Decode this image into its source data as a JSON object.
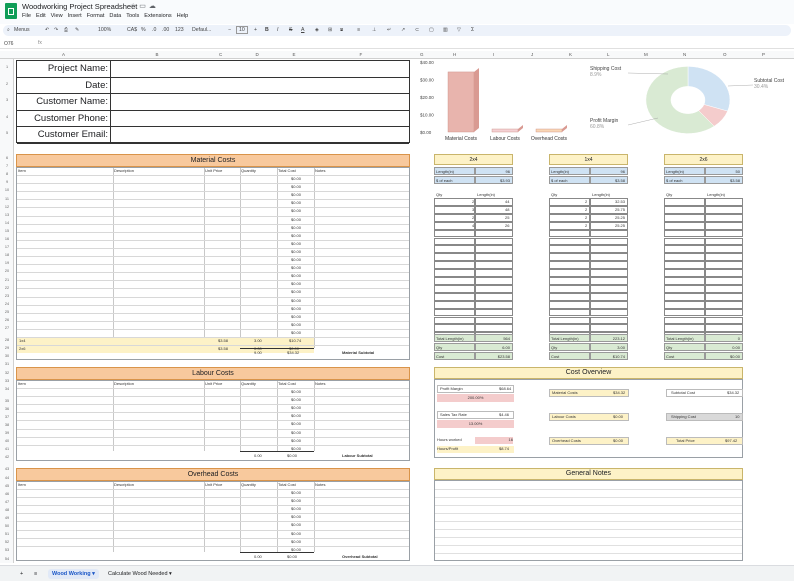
{
  "app": {
    "title": "Woodworking Project Spreadsheet",
    "menu": [
      "File",
      "Edit",
      "View",
      "Insert",
      "Format",
      "Data",
      "Tools",
      "Extensions",
      "Help"
    ],
    "toolbar": {
      "search": "Menus",
      "zoom": "100%",
      "currency": "CA$",
      "percent": "%",
      "dec1": ".0",
      "dec2": ".00",
      "num": "123",
      "font": "Defaul...",
      "fontsize": "10"
    },
    "cellref": "O76"
  },
  "columns": [
    "A",
    "B",
    "C",
    "D",
    "E",
    "F",
    "G",
    "H",
    "I",
    "J",
    "K",
    "L",
    "M",
    "N",
    "O",
    "P"
  ],
  "rows": [
    "1",
    "2",
    "3",
    "4",
    "5",
    "6",
    "7",
    "8",
    "9",
    "10",
    "11",
    "12",
    "13",
    "14",
    "15",
    "16",
    "17",
    "18",
    "19",
    "20",
    "21",
    "22",
    "23",
    "24",
    "25",
    "26",
    "27",
    "28",
    "29",
    "30",
    "31",
    "32",
    "33",
    "34",
    "35",
    "36",
    "37",
    "38",
    "39",
    "40",
    "41",
    "42",
    "43",
    "44",
    "45",
    "46",
    "47",
    "48",
    "49",
    "50",
    "51",
    "52",
    "53",
    "54"
  ],
  "project": {
    "labels": [
      "Project Name:",
      "Date:",
      "Customer Name:",
      "Customer Phone:",
      "Customer Email:"
    ]
  },
  "material": {
    "title": "Material Costs",
    "headers": [
      "Item",
      "Description",
      "Unit Price",
      "Quantity",
      "Total Cost",
      "Notes"
    ],
    "zero": "$0.00",
    "rows": [
      [
        "2x4",
        "$3.93",
        "6.00",
        "$23.58"
      ],
      [
        "1x4",
        "$3.58",
        "3.00",
        "$10.74"
      ],
      [
        "2x6",
        "$3.58",
        "0.00",
        "$0.00"
      ]
    ],
    "qty": "9.00",
    "subtotal": "$34.32",
    "subtotal_label": "Material Subtotal"
  },
  "labour": {
    "title": "Labour Costs",
    "headers": [
      "Item",
      "Description",
      "Unit Price",
      "Quantity",
      "Total Cost",
      "Notes"
    ],
    "qty": "0.00",
    "subtotal": "$0.00",
    "subtotal_label": "Labour Subtotal"
  },
  "overhead": {
    "title": "Overhead Costs",
    "headers": [
      "Item",
      "Description",
      "Unit Price",
      "Quantity",
      "Total Cost",
      "Notes"
    ],
    "qty": "0.00",
    "subtotal": "$0.00",
    "subtotal_label": "Overhead Subtotal"
  },
  "chart_data": [
    {
      "type": "bar",
      "categories": [
        "Material Costs",
        "Labour Costs",
        "Overhead Costs"
      ],
      "values": [
        34.32,
        0,
        0
      ],
      "ylim": [
        0,
        40
      ],
      "yticks": [
        "$40.00",
        "$30.00",
        "$20.00",
        "$10.00",
        "$0.00"
      ],
      "colors": [
        "#e8b4ad",
        "#f4d0d3",
        "#f9d6b5"
      ]
    },
    {
      "type": "pie",
      "labels": [
        "Shipping Cost",
        "Subtotal Cost",
        "Profit Margin"
      ],
      "percents": [
        "8.9%",
        "30.4%",
        "60.8%"
      ],
      "values": [
        8.9,
        30.4,
        60.8
      ],
      "colors": [
        "#f4cccc",
        "#cfe2f3",
        "#d9ead3"
      ]
    }
  ],
  "wood": [
    {
      "name": "2x4",
      "length_label": "Length(in)",
      "length": "96",
      "each_label": "$ of each",
      "each": "$3.93",
      "qty_label": "Qty",
      "len_label": "Length(in)",
      "cuts": [
        [
          "2",
          "44"
        ],
        [
          "3",
          "48"
        ],
        [
          "2",
          "25"
        ],
        [
          "4",
          "26"
        ]
      ],
      "total_label": "Total Length(in)",
      "total": "564",
      "qty_sum": "6.00",
      "cost_label": "Cost",
      "cost": "$23.58"
    },
    {
      "name": "1x4",
      "length_label": "Length(in)",
      "length": "96",
      "each_label": "$ of each",
      "each": "$3.58",
      "qty_label": "Qty",
      "len_label": "Length(in)",
      "cuts": [
        [
          "2",
          "32.53"
        ],
        [
          "2",
          "25.75"
        ],
        [
          "2",
          "25.25"
        ],
        [
          "2",
          "25.25"
        ]
      ],
      "total_label": "Total Length(in)",
      "total": "223.12",
      "qty_sum": "3.00",
      "cost_label": "Cost",
      "cost": "$10.74"
    },
    {
      "name": "2x6",
      "length_label": "Length(in)",
      "length": "50",
      "each_label": "$ of each",
      "each": "$3.58",
      "qty_label": "Qty",
      "len_label": "Length(in)",
      "cuts": [],
      "total_label": "Total Length(in)",
      "total": "0",
      "qty_sum": "0.00",
      "cost_label": "Cost",
      "cost": "$0.00"
    }
  ],
  "overview": {
    "title": "Cost Overview",
    "profit_margin_label": "Profit Margin",
    "profit_margin": "$68.64",
    "profit_pct": "200.00%",
    "tax_label": "Sales Tax Rate",
    "tax": "$4.46",
    "tax_pct": "13.00%",
    "hours_label": "Hours worked",
    "hours": "16",
    "hourly_label": "Hours/Profit",
    "hourly": "$8.74",
    "material_label": "Material Costs",
    "material": "$34.32",
    "labour_label": "Labour Costs",
    "labour": "$0.00",
    "overhead_label": "Overhead Costs",
    "overhead": "$0.00",
    "subtotal_label": "Subtotal Cost",
    "subtotal": "$34.32",
    "shipping_label": "Shipping Cost",
    "shipping": "10",
    "total_label": "Total Price",
    "total": "$97.42"
  },
  "notes": {
    "title": "General Notes"
  },
  "tabs": {
    "add": "+",
    "list": "≡",
    "sheet1": "Wood Working",
    "sheet2": "Calculate Wood Needed"
  }
}
